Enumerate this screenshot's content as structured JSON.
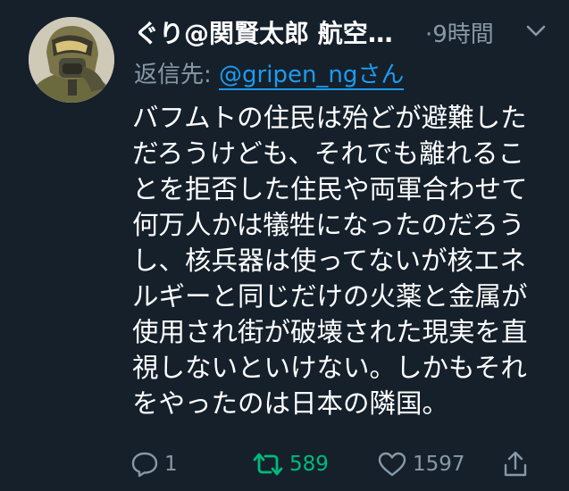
{
  "tweet": {
    "display_name": "ぐり@関賢太郎 航空…",
    "timestamp": "·9時間",
    "reply_prefix": "返信先: ",
    "reply_handle": "@gripen_ngさん",
    "body_lines": [
      "バフムトの住民は殆どが避難した",
      "だろうけども、それでも離れるこ",
      "とを拒否した住民や両軍合わせて",
      "何万人かは犠牲になったのだろう",
      "し、核兵器は使ってないが核エネ",
      "ルギーと同じだけの火薬と金属が",
      "使用され街が破壊された現実を直",
      "視しないといけない。しかもそれ",
      "をやったのは日本の隣国。"
    ]
  },
  "actions": {
    "reply_count": "1",
    "retweet_count": "589",
    "like_count": "1597"
  },
  "icons": {
    "more": "chevron-down-icon",
    "reply": "speech-bubble-icon",
    "retweet": "retweet-icon",
    "like": "heart-icon",
    "share": "share-icon"
  },
  "colors": {
    "background": "#15202b",
    "secondary_text": "#8899a6",
    "link": "#1d9bf0",
    "retweet_active": "#00ba7c"
  }
}
